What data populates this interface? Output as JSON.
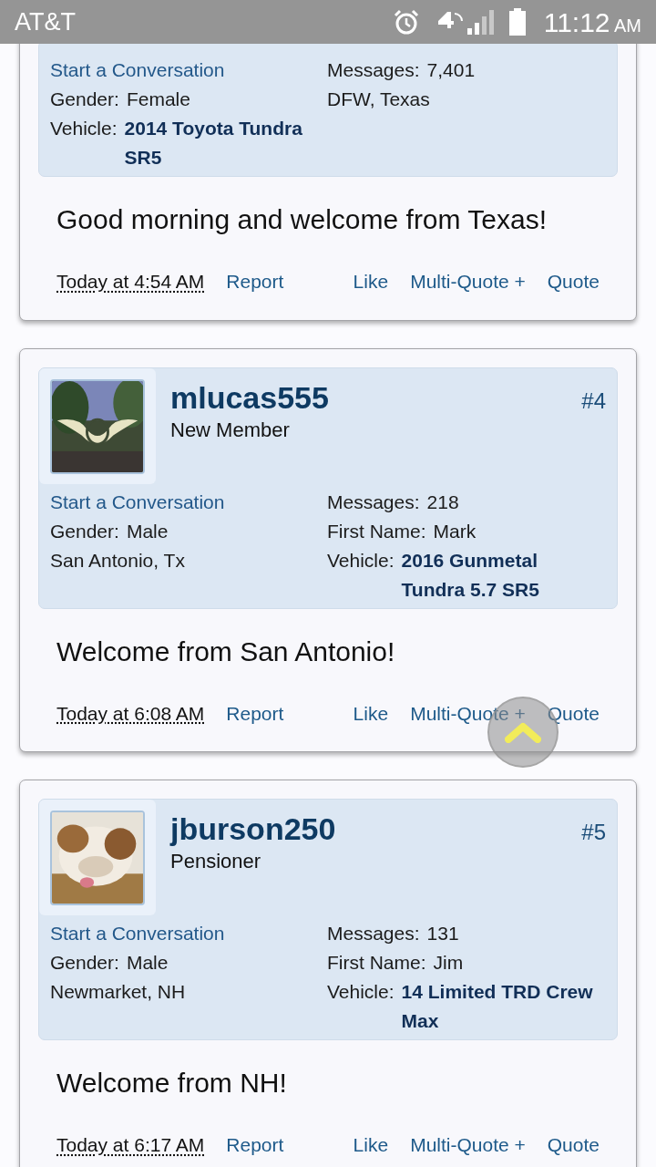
{
  "status_bar": {
    "carrier": "AT&T",
    "time": "11:12",
    "ampm": "AM"
  },
  "posts": [
    {
      "details_left": [
        {
          "kind": "link",
          "text": "Start a Conversation"
        },
        {
          "kind": "field",
          "label": "Gender:",
          "value": "Female"
        },
        {
          "kind": "vehicle",
          "label": "Vehicle:",
          "value": "2014 Toyota Tundra SR5"
        }
      ],
      "details_right": [
        {
          "kind": "field",
          "label": "Messages:",
          "value": "7,401"
        },
        {
          "kind": "text",
          "text": "DFW, Texas"
        }
      ],
      "message": "Good morning and welcome from Texas!",
      "date": "Today at 4:54 AM",
      "actions_left": [
        "Report"
      ],
      "actions_right": [
        "Like",
        "Multi-Quote +",
        "Quote"
      ]
    },
    {
      "username": "mlucas555",
      "user_title": "New Member",
      "number": "#4",
      "avatar": {
        "kind": "picture"
      },
      "details_left": [
        {
          "kind": "link",
          "text": "Start a Conversation"
        },
        {
          "kind": "field",
          "label": "Gender:",
          "value": "Male"
        },
        {
          "kind": "text",
          "text": "San Antonio, Tx"
        }
      ],
      "details_right": [
        {
          "kind": "field",
          "label": "Messages:",
          "value": "218"
        },
        {
          "kind": "field",
          "label": "First Name:",
          "value": "Mark"
        },
        {
          "kind": "vehicle",
          "label": "Vehicle:",
          "value": "2016 Gunmetal Tundra 5.7 SR5"
        }
      ],
      "message": "Welcome from San Antonio!",
      "date": "Today at 6:08 AM",
      "actions_left": [
        "Report"
      ],
      "actions_right": [
        "Like",
        "Multi-Quote +",
        "Quote"
      ]
    },
    {
      "username": "jburson250",
      "user_title": "Pensioner",
      "number": "#5",
      "avatar": {
        "kind": "picture"
      },
      "details_left": [
        {
          "kind": "link",
          "text": "Start a Conversation"
        },
        {
          "kind": "field",
          "label": "Gender:",
          "value": "Male"
        },
        {
          "kind": "text",
          "text": "Newmarket, NH"
        }
      ],
      "details_right": [
        {
          "kind": "field",
          "label": "Messages:",
          "value": "131"
        },
        {
          "kind": "field",
          "label": "First Name:",
          "value": "Jim"
        },
        {
          "kind": "vehicle",
          "label": "Vehicle:",
          "value": "14 Limited TRD Crew Max"
        }
      ],
      "message": "Welcome from NH!",
      "date": "Today at 6:17 AM",
      "actions_left": [
        "Report"
      ],
      "actions_right": [
        "Like",
        "Multi-Quote +",
        "Quote"
      ]
    }
  ]
}
